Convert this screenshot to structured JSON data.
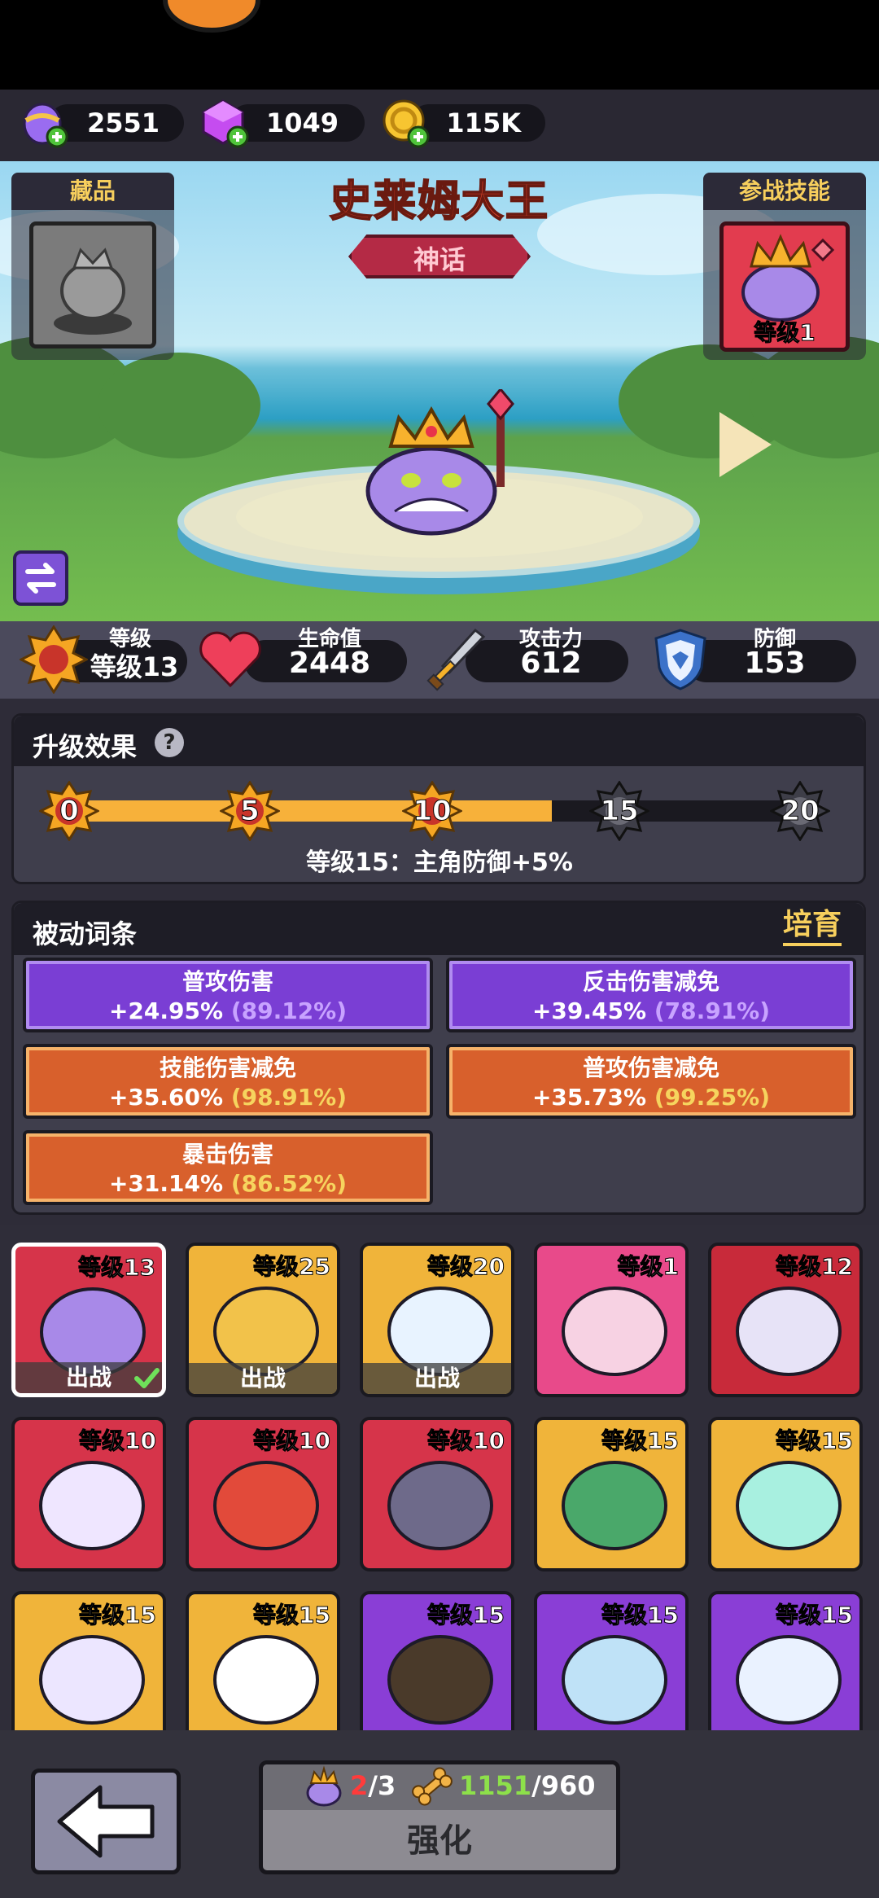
{
  "currencies": [
    {
      "name": "egg",
      "value": "2551",
      "icon": "egg-plus-icon"
    },
    {
      "name": "gem",
      "value": "1049",
      "icon": "gem-plus-icon"
    },
    {
      "name": "gold",
      "value": "115K",
      "icon": "gold-coin-plus-icon"
    }
  ],
  "hero": {
    "name": "史莱姆大王",
    "rarity": "神话",
    "collection_label": "藏品",
    "skill_label": "参战技能",
    "skill_level": "等级1"
  },
  "stats": {
    "level_label": "等级",
    "level_value": "等级13",
    "hp_label": "生命值",
    "hp_value": "2448",
    "atk_label": "攻击力",
    "atk_value": "612",
    "def_label": "防御",
    "def_value": "153"
  },
  "upgrade": {
    "title": "升级效果",
    "help": "?",
    "milestones": [
      "0",
      "5",
      "10",
      "15",
      "20"
    ],
    "progress_fraction": 0.65,
    "next_effect": "等级15：主角防御+5%"
  },
  "passive": {
    "title": "被动词条",
    "action": "培育",
    "traits": [
      {
        "name": "普攻伤害",
        "value": "+24.95%",
        "pct": "(89.12%)"
      },
      {
        "name": "反击伤害减免",
        "value": "+39.45%",
        "pct": "(78.91%)"
      },
      {
        "name": "技能伤害减免",
        "value": "+35.60%",
        "pct": "(98.91%)"
      },
      {
        "name": "普攻伤害减免",
        "value": "+35.73%",
        "pct": "(99.25%)"
      },
      {
        "name": "暴击伤害",
        "value": "+31.14%",
        "pct": "(86.52%)"
      }
    ]
  },
  "roster": {
    "deploy_label": "出战",
    "cards": [
      {
        "level": "等级13"
      },
      {
        "level": "等级25"
      },
      {
        "level": "等级20"
      },
      {
        "level": "等级1"
      },
      {
        "level": "等级12"
      },
      {
        "level": "等级10"
      },
      {
        "level": "等级10"
      },
      {
        "level": "等级10"
      },
      {
        "level": "等级15"
      },
      {
        "level": "等级15"
      },
      {
        "level": "等级15"
      },
      {
        "level": "等级15"
      },
      {
        "level": "等级15"
      },
      {
        "level": "等级15"
      },
      {
        "level": "等级15"
      }
    ]
  },
  "footer": {
    "shard_have": "2",
    "shard_need": "/3",
    "bone_have": "1151",
    "bone_need": "/960",
    "upgrade_label": "强化"
  },
  "colors": {
    "accent_gold": "#f7cf5d",
    "red_text": "#f04b2f",
    "purple_trait": "#7a3ed4",
    "orange_trait": "#d8602c"
  }
}
